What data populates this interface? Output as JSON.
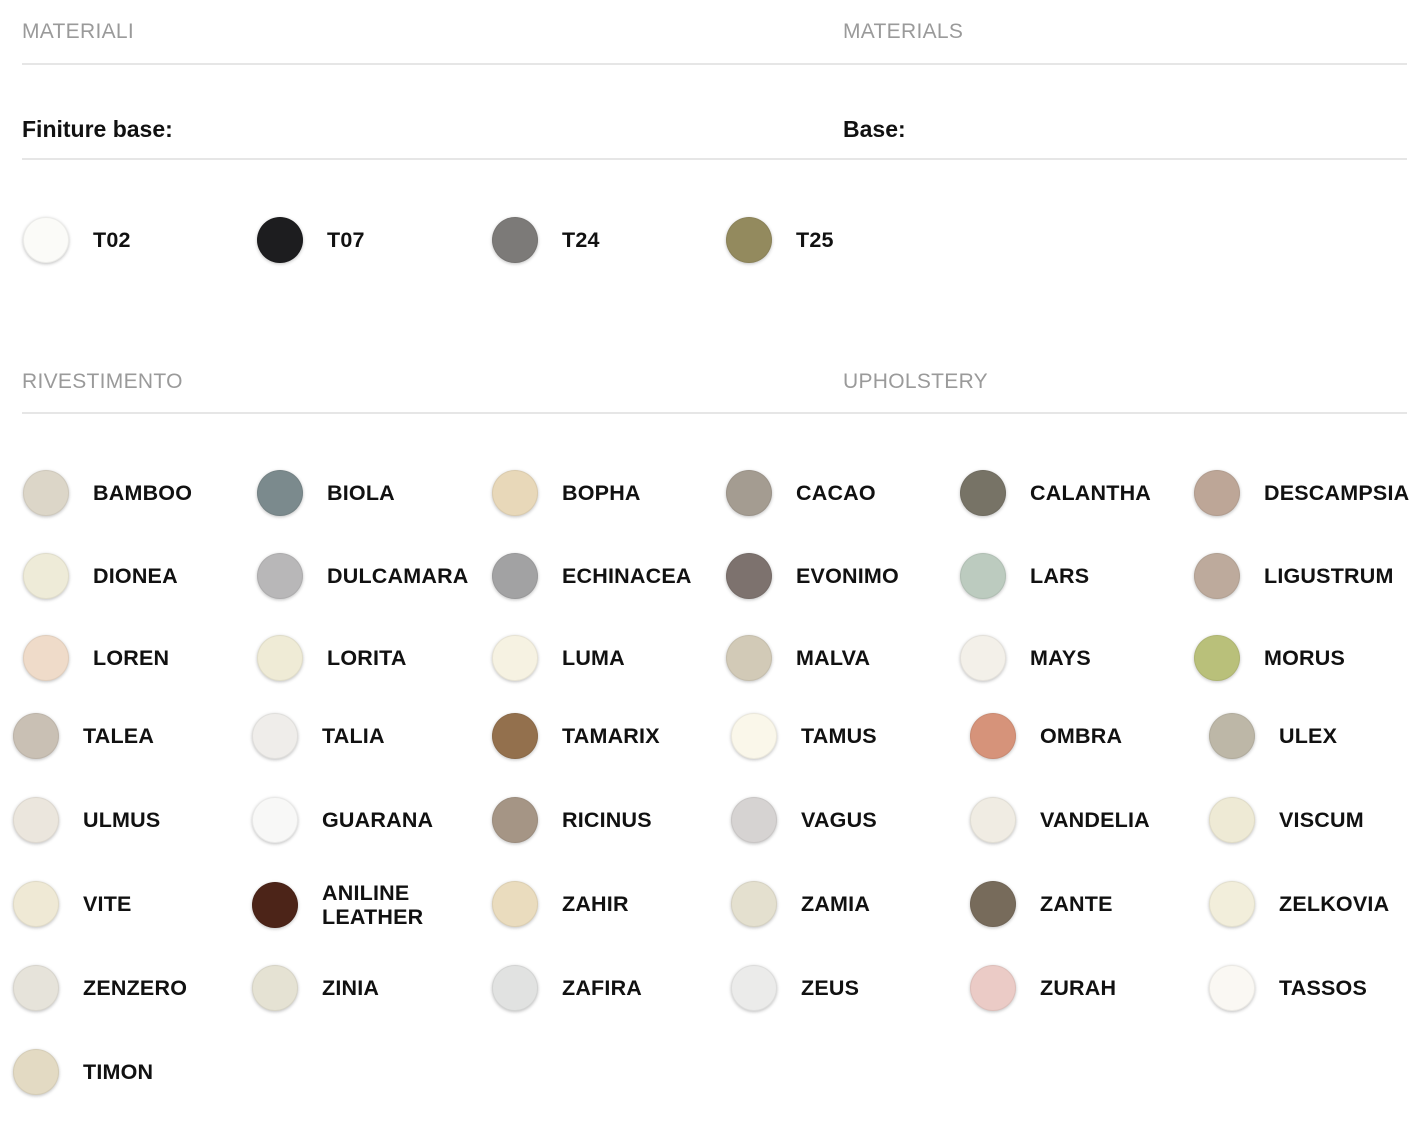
{
  "materials": {
    "title_it": "MATERIALI",
    "title_en": "MATERIALS",
    "base_it": "Finiture base:",
    "base_en": "Base:",
    "finishes": [
      {
        "code": "T02",
        "color": "#fbfbf8"
      },
      {
        "code": "T07",
        "color": "#1d1d1f"
      },
      {
        "code": "T24",
        "color": "#7c7a78"
      },
      {
        "code": "T25",
        "color": "#938a5e"
      }
    ]
  },
  "upholstery": {
    "title_it": "RIVESTIMENTO",
    "title_en": "UPHOLSTERY",
    "fabrics": [
      {
        "name": "BAMBOO",
        "color": "#dcd6c8"
      },
      {
        "name": "BIOLA",
        "color": "#7b8a8d"
      },
      {
        "name": "BOPHA",
        "color": "#e8d8b9"
      },
      {
        "name": "CACAO",
        "color": "#a49c91"
      },
      {
        "name": "CALANTHA",
        "color": "#777366"
      },
      {
        "name": "DESCAMPSIA",
        "color": "#bda697"
      },
      {
        "name": "DIONEA",
        "color": "#eeebd8"
      },
      {
        "name": "DULCAMARA",
        "color": "#b8b7b8"
      },
      {
        "name": "ECHINACEA",
        "color": "#a2a2a3"
      },
      {
        "name": "EVONIMO",
        "color": "#7d726e"
      },
      {
        "name": "LARS",
        "color": "#bccbbf"
      },
      {
        "name": "LIGUSTRUM",
        "color": "#bdaa9c"
      },
      {
        "name": "LOREN",
        "color": "#efdbc9"
      },
      {
        "name": "LORITA",
        "color": "#efebd6"
      },
      {
        "name": "LUMA",
        "color": "#f6f2e2"
      },
      {
        "name": "MALVA",
        "color": "#d2cab7"
      },
      {
        "name": "MAYS",
        "color": "#f3f0e9"
      },
      {
        "name": "MORUS",
        "color": "#b9c07a"
      },
      {
        "name": "TALEA",
        "color": "#c9c0b4"
      },
      {
        "name": "TALIA",
        "color": "#efedea"
      },
      {
        "name": "TAMARIX",
        "color": "#93704d"
      },
      {
        "name": "TAMUS",
        "color": "#faf7ea"
      },
      {
        "name": "OMBRA",
        "color": "#d6937a"
      },
      {
        "name": "ULEX",
        "color": "#bdb7a7"
      },
      {
        "name": "ULMUS",
        "color": "#ebe6dd"
      },
      {
        "name": "GUARANA",
        "color": "#f8f8f7"
      },
      {
        "name": "RICINUS",
        "color": "#a59585"
      },
      {
        "name": "VAGUS",
        "color": "#d6d3d2"
      },
      {
        "name": "VANDELIA",
        "color": "#f0ece3"
      },
      {
        "name": "VISCUM",
        "color": "#eeead5"
      },
      {
        "name": "VITE",
        "color": "#efe9d5"
      },
      {
        "name": "ANILINE LEATHER",
        "color": "#4c2418"
      },
      {
        "name": "ZAHIR",
        "color": "#eadcbe"
      },
      {
        "name": "ZAMIA",
        "color": "#e4e0cf"
      },
      {
        "name": "ZANTE",
        "color": "#776b5b"
      },
      {
        "name": "ZELKOVIA",
        "color": "#f2eedb"
      },
      {
        "name": "ZENZERO",
        "color": "#e6e3da"
      },
      {
        "name": "ZINIA",
        "color": "#e5e2d3"
      },
      {
        "name": "ZAFIRA",
        "color": "#e1e2e1"
      },
      {
        "name": "ZEUS",
        "color": "#ebebea"
      },
      {
        "name": "ZURAH",
        "color": "#ebcbc6"
      },
      {
        "name": "TASSOS",
        "color": "#faf8f3"
      },
      {
        "name": "TIMON",
        "color": "#e3dac3"
      }
    ]
  }
}
